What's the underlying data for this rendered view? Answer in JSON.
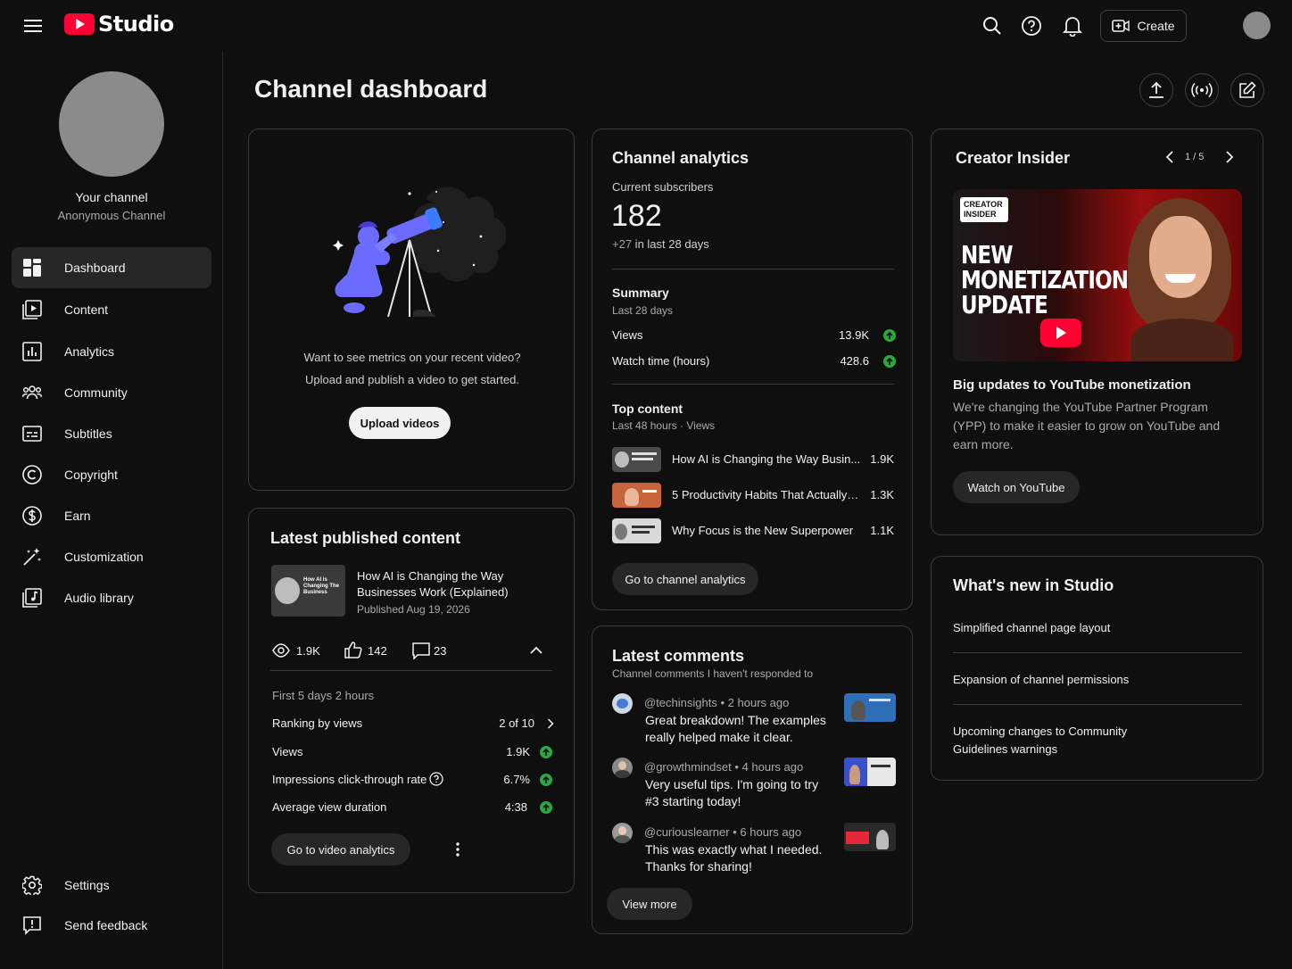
{
  "app": {
    "logo_text": "Studio"
  },
  "header": {
    "create_label": "Create"
  },
  "sidebar": {
    "channel_name": "Your channel",
    "channel_handle": "Anonymous Channel",
    "items": [
      {
        "label": "Dashboard"
      },
      {
        "label": "Content"
      },
      {
        "label": "Analytics"
      },
      {
        "label": "Community"
      },
      {
        "label": "Subtitles"
      },
      {
        "label": "Copyright"
      },
      {
        "label": "Earn"
      },
      {
        "label": "Customization"
      },
      {
        "label": "Audio library"
      }
    ],
    "settings_label": "Settings",
    "feedback_label": "Send feedback"
  },
  "main": {
    "title": "Channel dashboard"
  },
  "upload_card": {
    "line1": "Want to see metrics on your recent video?",
    "line2": "Upload and publish a video to get started.",
    "button": "Upload videos"
  },
  "latest_content": {
    "title": "Latest published content",
    "video_title_line1": "How AI is Changing the Way",
    "video_title_line2": "Businesses Work (Explained)",
    "published": "Published Aug 19, 2026",
    "thumb_text": "How AI is Changing The Business",
    "views_count": "1.9K",
    "likes_count": "142",
    "comments_count": "23",
    "period": "First 5 days 2 hours",
    "ranking_label": "Ranking by views",
    "ranking_value": "2 of 10",
    "views_label": "Views",
    "views_value": "1.9K",
    "ctr_label": "Impressions click-through rate",
    "ctr_value": "6.7%",
    "avd_label": "Average view duration",
    "avd_value": "4:38",
    "button": "Go to video analytics"
  },
  "analytics": {
    "title": "Channel analytics",
    "subs_label": "Current subscribers",
    "subs_value": "182",
    "subs_delta": "+27",
    "subs_delta_suffix": " in last 28 days",
    "summary_title": "Summary",
    "summary_period": "Last 28 days",
    "views_label": "Views",
    "views_value": "13.9K",
    "watch_label": "Watch time (hours)",
    "watch_value": "428.6",
    "top_title": "Top content",
    "top_period": "Last 48 hours · Views",
    "top_items": [
      {
        "title": "How AI is Changing the Way Busin...",
        "views": "1.9K"
      },
      {
        "title": "5 Productivity Habits That Actually ...",
        "views": "1.3K"
      },
      {
        "title": "Why Focus is the New Superpower",
        "views": "1.1K"
      }
    ],
    "button": "Go to channel analytics"
  },
  "comments": {
    "title": "Latest comments",
    "subtitle": "Channel comments I haven't responded to",
    "items": [
      {
        "user": "@techinsights",
        "time": "2 hours ago",
        "line1": "Great breakdown! The examples",
        "line2": "really helped make it clear."
      },
      {
        "user": "@growthmindset",
        "time": "4 hours ago",
        "line1": "Very useful tips. I'm going to try",
        "line2": "#3 starting today!"
      },
      {
        "user": "@curiouslearner",
        "time": "6 hours ago",
        "line1": "This was exactly what I needed.",
        "line2": "Thanks for sharing!"
      }
    ],
    "separator": "•",
    "button": "View more"
  },
  "creator_insider": {
    "title": "Creator Insider",
    "pager": "1 / 5",
    "badge_line1": "CREATOR",
    "badge_line2": "INSIDER",
    "thumb_line1": "NEW",
    "thumb_line2": "MONETIZATION",
    "thumb_line3": "UPDATE",
    "headline": "Big updates to YouTube monetization",
    "desc_line1": "We're changing the YouTube Partner Program",
    "desc_line2": "(YPP) to make it easier to grow on YouTube and",
    "desc_line3": "earn more.",
    "button": "Watch on YouTube"
  },
  "whats_new": {
    "title": "What's new in Studio",
    "items": [
      {
        "line1": "Simplified channel page layout",
        "line2": ""
      },
      {
        "line1": "Expansion of channel permissions",
        "line2": ""
      },
      {
        "line1": "Upcoming changes to Community",
        "line2": "Guidelines warnings"
      }
    ]
  },
  "colors": {
    "accent_green": "#2ba640",
    "brand_red": "#ff0033",
    "background": "#0f0f0f"
  }
}
